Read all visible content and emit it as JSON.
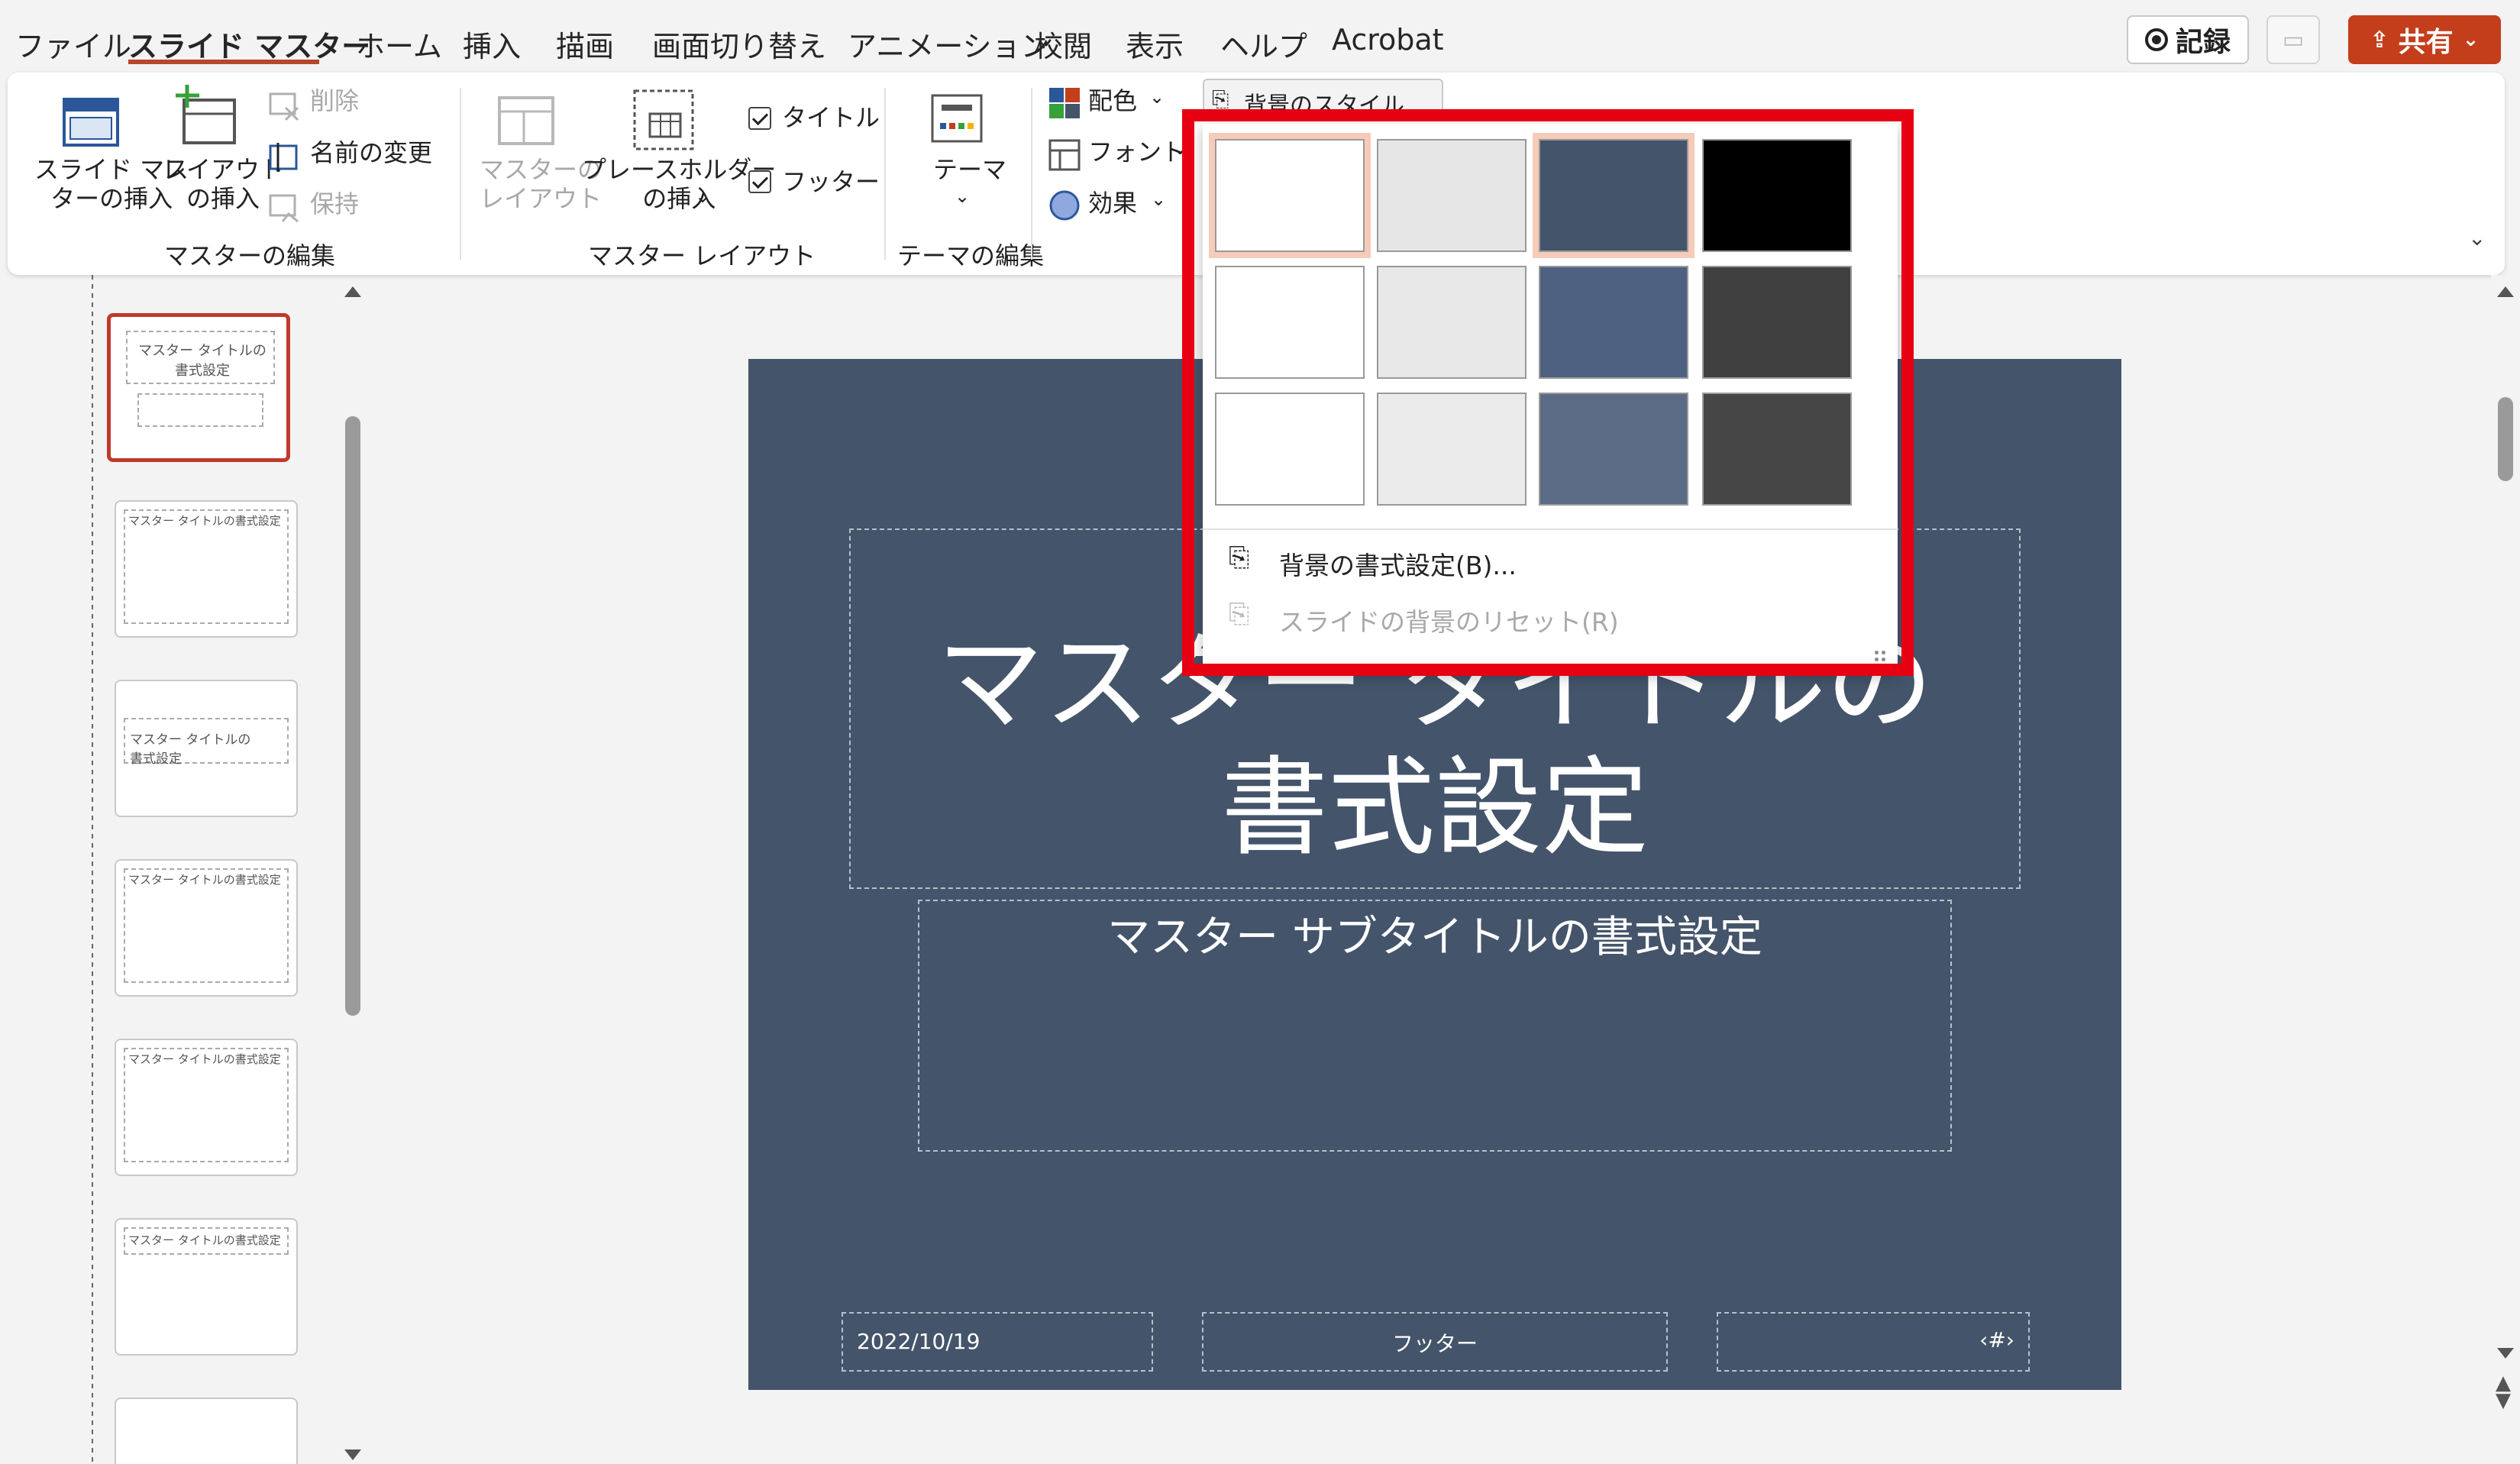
{
  "menu": {
    "tabs": [
      "ファイル",
      "スライド マスター",
      "ホーム",
      "挿入",
      "描画",
      "画面切り替え",
      "アニメーション",
      "校閲",
      "表示",
      "ヘルプ",
      "Acrobat"
    ],
    "record_label": "記録",
    "share_label": "共有"
  },
  "ribbon": {
    "insert_master": "スライド マス\nターの挿入",
    "insert_layout": "レイアウト\nの挿入",
    "delete": "削除",
    "rename": "名前の変更",
    "preserve": "保持",
    "group_master_edit": "マスターの編集",
    "master_layout": "マスターの\nレイアウト",
    "insert_placeholder": "プレースホルダー\nの挿入",
    "title_check": "タイトル",
    "footer_check": "フッター",
    "group_master_layout": "マスター レイアウト",
    "theme": "テーマ",
    "group_theme_edit": "テーマの編集",
    "colors": "配色",
    "fonts": "フォント",
    "effects": "効果",
    "bg_styles": "背景のスタイル"
  },
  "gallery": {
    "swatches": [
      [
        "#ffffff",
        "#e6e6e6",
        "#44546a",
        "#000000"
      ],
      [
        "#ffffff",
        "#e8e8e8",
        "#4f6181",
        "#404040"
      ],
      [
        "#ffffff",
        "#ebebeb",
        "#5b6b85",
        "#464646"
      ]
    ],
    "format_bg": "背景の書式設定(B)...",
    "reset_bg": "スライドの背景のリセット(R)"
  },
  "slide": {
    "title_line1": "マスター タイトルの",
    "title_line2": "書式設定",
    "subtitle": "マスター サブタイトルの書式設定",
    "date": "2022/10/19",
    "footer": "フッター",
    "slide_number": "‹#›",
    "background": "#44546a"
  },
  "thumbnails": {
    "t1": "マスター タイトルの\n書式設定",
    "t2": "マスター タイトルの書式設定",
    "t3": "マスター タイトルの\n書式設定",
    "t4": "マスター タイトルの書式設定",
    "t5": "マスター タイトルの書式設定",
    "t6": "マスター タイトルの書式設定"
  }
}
